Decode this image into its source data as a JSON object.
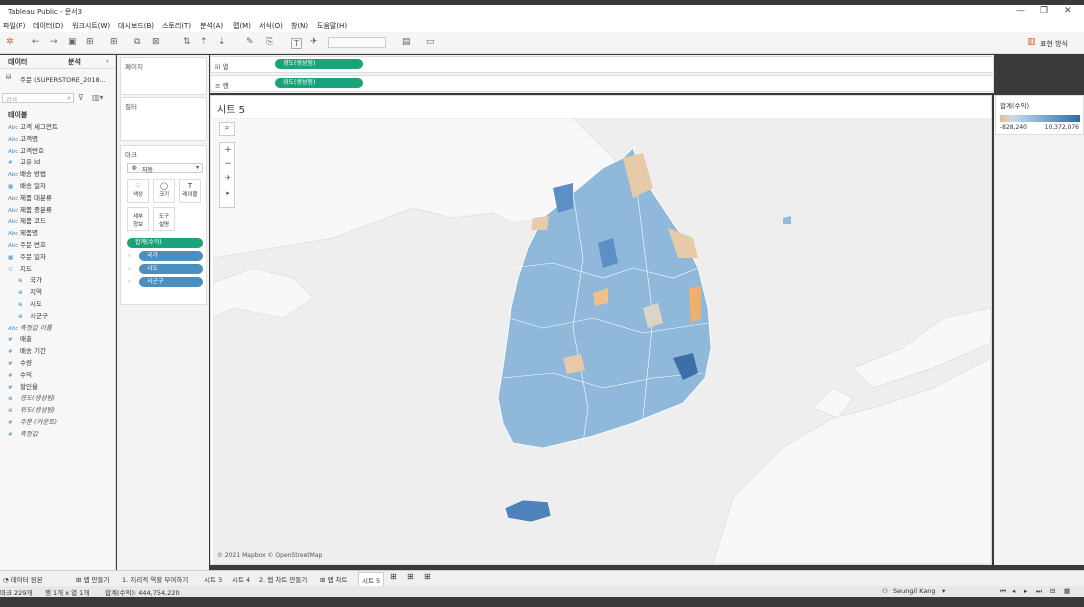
{
  "window": {
    "title": "Tableau Public - 문서3",
    "controls": [
      "—",
      "❐",
      "✕"
    ]
  },
  "menu": [
    "파일(F)",
    "데이터(D)",
    "워크시트(W)",
    "대시보드(B)",
    "스토리(T)",
    "분석(A)",
    "맵(M)",
    "서식(O)",
    "창(N)",
    "도움말(H)"
  ],
  "toolbar": {
    "show_me": "표현 방식"
  },
  "data_pane": {
    "tab_data": "데이터",
    "tab_analysis": "분석",
    "datasource": "주문 (SUPERSTORE_2018...",
    "search_placeholder": "검색",
    "section_tables": "테이블",
    "fields": [
      {
        "icon": "Abc",
        "label": "고객 세그먼트",
        "italic": false
      },
      {
        "icon": "Abc",
        "label": "고객명",
        "italic": false
      },
      {
        "icon": "Abc",
        "label": "고객번호",
        "italic": false
      },
      {
        "icon": "#",
        "label": "고유 Id",
        "italic": false
      },
      {
        "icon": "Abc",
        "label": "배송 방법",
        "italic": false
      },
      {
        "icon": "▦",
        "label": "배송 일자",
        "italic": false
      },
      {
        "icon": "Abc",
        "label": "제품 대분류",
        "italic": false
      },
      {
        "icon": "Abc",
        "label": "제품 중분류",
        "italic": false
      },
      {
        "icon": "Abc",
        "label": "제품 코드",
        "italic": false
      },
      {
        "icon": "Abc",
        "label": "제품명",
        "italic": false
      },
      {
        "icon": "Abc",
        "label": "주문 번호",
        "italic": false
      },
      {
        "icon": "▦",
        "label": "주문 일자",
        "italic": false
      },
      {
        "icon": "⚇",
        "label": "지도",
        "italic": false
      },
      {
        "icon": "⊕",
        "label": "국가",
        "italic": false,
        "indent": true
      },
      {
        "icon": "⊕",
        "label": "지역",
        "italic": false,
        "indent": true
      },
      {
        "icon": "⊕",
        "label": "시도",
        "italic": false,
        "indent": true
      },
      {
        "icon": "⊕",
        "label": "시군구",
        "italic": false,
        "indent": true
      },
      {
        "icon": "Abc",
        "label": "측정값 이름",
        "italic": true
      },
      {
        "icon": "#",
        "label": "매출",
        "italic": false
      },
      {
        "icon": "#",
        "label": "배송 기간",
        "italic": false
      },
      {
        "icon": "#",
        "label": "수량",
        "italic": false
      },
      {
        "icon": "#",
        "label": "수익",
        "italic": false
      },
      {
        "icon": "#",
        "label": "할인율",
        "italic": false
      },
      {
        "icon": "⊕",
        "label": "경도(생성됨)",
        "italic": true
      },
      {
        "icon": "⊕",
        "label": "위도(생성됨)",
        "italic": true
      },
      {
        "icon": "#",
        "label": "주문 (카운트)",
        "italic": true
      },
      {
        "icon": "#",
        "label": "측정값",
        "italic": true
      }
    ]
  },
  "cards": {
    "pages": "페이지",
    "filters": "필터",
    "marks": "마크",
    "mark_type": "자동",
    "mark_buttons": [
      "색상",
      "크기",
      "레이블",
      "세부\n정보",
      "도구\n설명"
    ],
    "mark_pills": [
      "합계(수익)",
      "국가",
      "시도",
      "시군구"
    ]
  },
  "shelves": {
    "columns_label": "열",
    "columns_pill": "경도(생성됨)",
    "rows_label": "행",
    "rows_pill": "위도(생성됨)"
  },
  "view": {
    "title": "시트 5",
    "attribution": "© 2021 Mapbox © OpenStreetMap"
  },
  "legend": {
    "title": "합계(수익)",
    "min": "-828,240",
    "max": "10,372,076",
    "color_low": "#f0b77a",
    "color_high": "#2f6aa3"
  },
  "sheet_tabs": [
    "데이터 원본",
    "맵 만들기",
    "1. 지리적 역할 부여하기",
    "시트 3",
    "시트 4",
    "2. 맵 차트 만들기",
    "맵 차트",
    "시트 5"
  ],
  "status": {
    "marks": "마크 229개",
    "rowscols": "행 1개 x 열 1개",
    "sum": "합계(수익): 444,754,220",
    "user": "Seungil Kang"
  }
}
